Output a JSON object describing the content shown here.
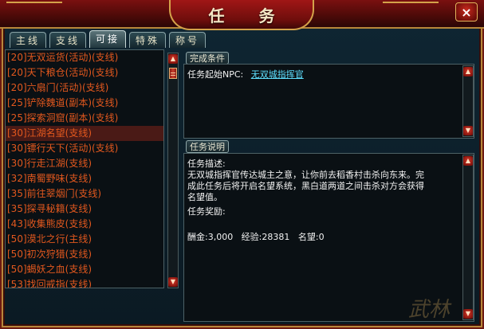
{
  "window": {
    "title": "任 务",
    "close_glyph": "×"
  },
  "tabs": [
    {
      "label": "主线",
      "active": false
    },
    {
      "label": "支线",
      "active": false
    },
    {
      "label": "可接",
      "active": true
    },
    {
      "label": "特殊",
      "active": false
    },
    {
      "label": "称号",
      "active": false
    }
  ],
  "quest_list": [
    {
      "text": "[20]无双运货(活动)(支线)",
      "selected": false
    },
    {
      "text": "[20]天下粮仓(活动)(支线)",
      "selected": false
    },
    {
      "text": "[20]六扇门(活动)(支线)",
      "selected": false
    },
    {
      "text": "[25]铲除魏道(副本)(支线)",
      "selected": false
    },
    {
      "text": "[25]探索洞窟(副本)(支线)",
      "selected": false
    },
    {
      "text": "[30]江湖名望(支线)",
      "selected": true
    },
    {
      "text": "[30]镖行天下(活动)(支线)",
      "selected": false
    },
    {
      "text": "[30]行走江湖(支线)",
      "selected": false
    },
    {
      "text": "[32]南蜀野味(支线)",
      "selected": false
    },
    {
      "text": "[35]前往翠烟门(支线)",
      "selected": false
    },
    {
      "text": "[35]探寻秘籍(支线)",
      "selected": false
    },
    {
      "text": "[43]收集熊皮(支线)",
      "selected": false
    },
    {
      "text": "[50]漠北之行(主线)",
      "selected": false
    },
    {
      "text": "[50]初次狩猎(支线)",
      "selected": false
    },
    {
      "text": "[50]蝎妖之血(支线)",
      "selected": false
    },
    {
      "text": "[53]找回戒指(支线)",
      "selected": false
    }
  ],
  "completion": {
    "section_label": "完成条件",
    "npc_prefix": "任务起始NPC:",
    "npc_name": "无双城指挥官"
  },
  "description": {
    "section_label": "任务说明",
    "heading": "任务描述:",
    "lines": [
      "无双城指挥官传达城主之意，让你前去稻香村击杀向东来。完",
      "成此任务后将开启名望系统，黑白道两道之间击杀对方会获得",
      "名望值。"
    ],
    "reward_heading": "任务奖励:",
    "rewards": "酬金:3,000   经验:28381   名望:0"
  },
  "watermark": "武林"
}
